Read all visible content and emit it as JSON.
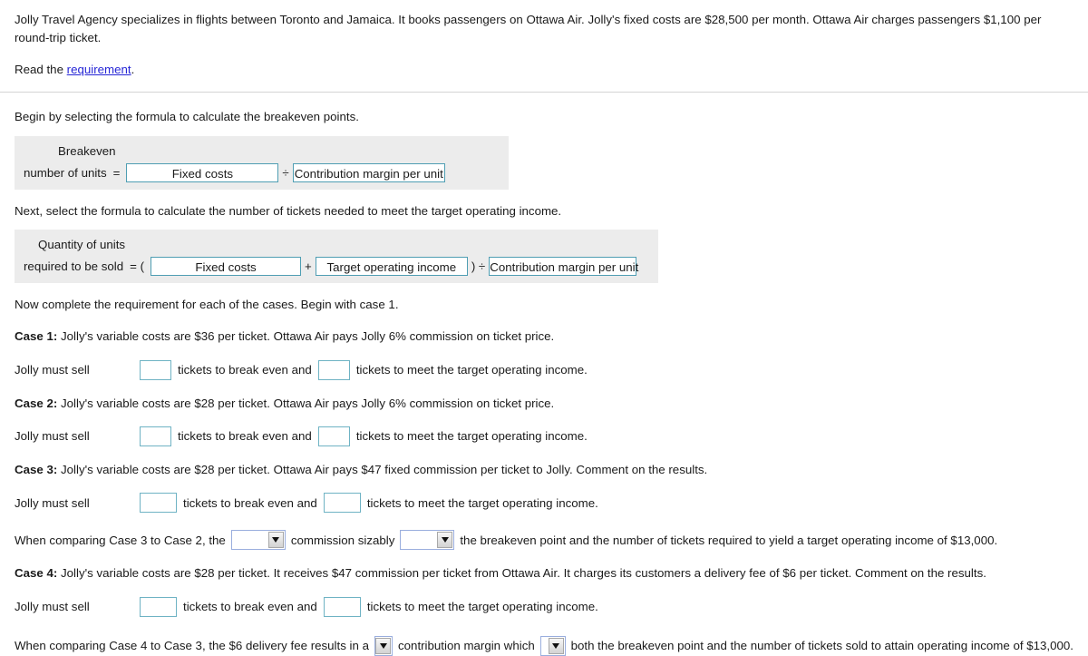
{
  "intro": {
    "paragraph": "Jolly Travel Agency specializes in flights between Toronto and Jamaica. It books passengers on Ottawa Air. Jolly's fixed costs are $28,500 per month. Ottawa Air charges passengers $1,100 per round-trip ticket.",
    "read_prefix": "Read the ",
    "link_label": "requirement",
    "read_suffix": "."
  },
  "breakeven_section": {
    "instruction": "Begin by selecting the formula to calculate the breakeven points.",
    "label_line1": "Breakeven",
    "label_line2": "number of units",
    "equals": "=",
    "numerator": "Fixed costs",
    "divide": "÷",
    "denominator": "Contribution margin per unit"
  },
  "target_section": {
    "instruction": "Next, select the formula to calculate the number of tickets needed to meet the target operating income.",
    "label_line1": "Quantity of units",
    "label_line2": "required to be sold",
    "equals_open": "= (",
    "numerator_a": "Fixed costs",
    "plus": "+",
    "numerator_b": "Target operating income",
    "close_divide": ") ÷",
    "denominator": "Contribution margin per unit"
  },
  "cases_intro": "Now complete the requirement for each of the cases. Begin with case 1.",
  "answer_row_template": {
    "lead": "Jolly must sell",
    "middle": "tickets to break even and",
    "tail": "tickets to meet the target operating income."
  },
  "cases": [
    {
      "label": "Case 1:",
      "text": " Jolly's variable costs are $36 per ticket. Ottawa Air pays Jolly 6% commission on ticket price.",
      "box1_value": "",
      "box2_value": ""
    },
    {
      "label": "Case 2:",
      "text": " Jolly's variable costs are $28 per ticket. Ottawa Air pays Jolly 6% commission on ticket price.",
      "box1_value": "",
      "box2_value": ""
    },
    {
      "label": "Case 3:",
      "text": " Jolly's variable costs are $28 per ticket. Ottawa Air pays $47 fixed commission per ticket to Jolly. Comment on the results.",
      "box1_value": "",
      "box2_value": ""
    },
    {
      "label": "Case 4:",
      "text": " Jolly's variable costs are $28 per ticket. It receives $47 commission per ticket from Ottawa Air. It charges its customers a delivery fee of $6 per ticket. Comment on the results.",
      "box1_value": "",
      "box2_value": ""
    }
  ],
  "comparison_3_2": {
    "part1": "When comparing Case 3 to Case 2, the",
    "select1_value": "",
    "part2": "commission sizably",
    "select2_value": "",
    "part3": "the breakeven point and the number of tickets required to yield a target operating income of $13,000."
  },
  "comparison_4_3": {
    "part1": "When comparing Case 4 to Case 3, the $6 delivery fee results in a",
    "select1_value": "",
    "part2": "contribution margin which",
    "select2_value": "",
    "part3": "both the breakeven point and the number of tickets sold to attain operating income of $13,000."
  },
  "colors": {
    "panel_bg": "#ececec",
    "formula_box_border": "#4f9eb3",
    "answer_box_border": "#6fb3c4",
    "select_border": "#9aaede",
    "link": "#2626d6"
  }
}
